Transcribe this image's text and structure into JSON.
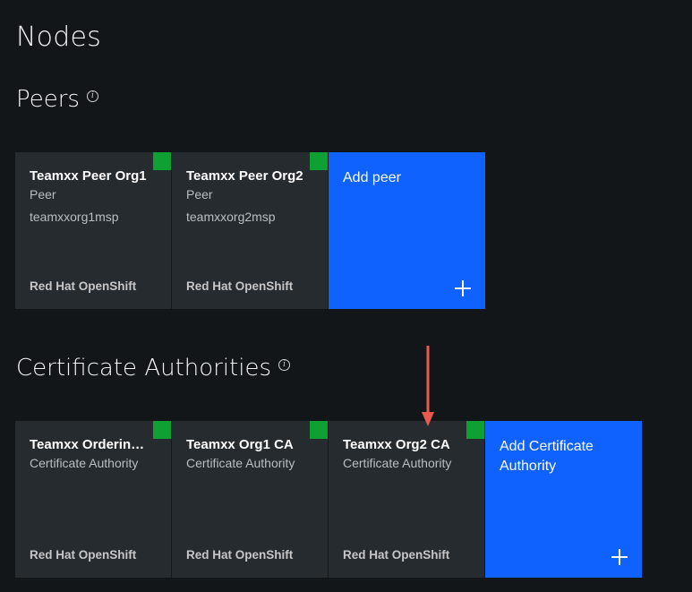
{
  "page": {
    "title": "Nodes"
  },
  "peers": {
    "title": "Peers",
    "tiles": [
      {
        "name": "Teamxx Peer Org1",
        "type": "Peer",
        "msp": "teamxxorg1msp",
        "platform": "Red Hat OpenShift",
        "status_color": "#0ea032"
      },
      {
        "name": "Teamxx Peer Org2",
        "type": "Peer",
        "msp": "teamxxorg2msp",
        "platform": "Red Hat OpenShift",
        "status_color": "#0ea032"
      }
    ],
    "add_label": "Add peer"
  },
  "cas": {
    "title": "Certificate Authorities",
    "tiles": [
      {
        "name": "Teamxx Ordering Service CA",
        "type": "Certificate Authority",
        "platform": "Red Hat OpenShift",
        "status_color": "#0ea032"
      },
      {
        "name": "Teamxx Org1 CA",
        "type": "Certificate Authority",
        "platform": "Red Hat OpenShift",
        "status_color": "#0ea032"
      },
      {
        "name": "Teamxx Org2 CA",
        "type": "Certificate Authority",
        "platform": "Red Hat OpenShift",
        "status_color": "#0ea032"
      }
    ],
    "add_label": "Add Certificate Authority"
  },
  "icons": {
    "info": "info-icon",
    "add": "plus-icon",
    "status": "status-indicator",
    "annotation": "red-arrow"
  },
  "colors": {
    "background": "#121619",
    "tile": "#262b2f",
    "accent": "#0f62fe",
    "status_ok": "#0ea032",
    "annotation_arrow": "#e8594e"
  }
}
